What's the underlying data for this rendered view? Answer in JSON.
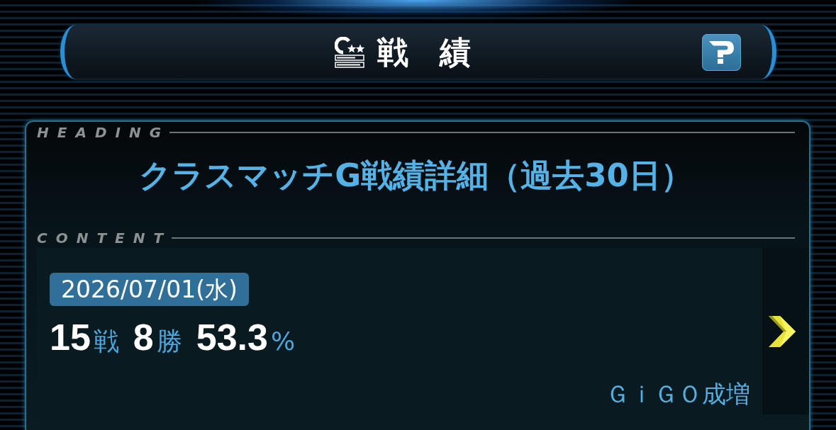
{
  "header": {
    "title": "戦　績"
  },
  "heading": {
    "label": "HEADING",
    "title": "クラスマッチG戦績詳細（過去30日）"
  },
  "content": {
    "label": "CONTENT",
    "records": [
      {
        "date": "2026/07/01(水)",
        "stats": [
          {
            "value": "15",
            "unit": "戦"
          },
          {
            "value": "8",
            "unit": "勝"
          },
          {
            "value": "53.3",
            "unit": "%"
          }
        ],
        "store": "ＧｉＧＯ成増"
      }
    ]
  }
}
